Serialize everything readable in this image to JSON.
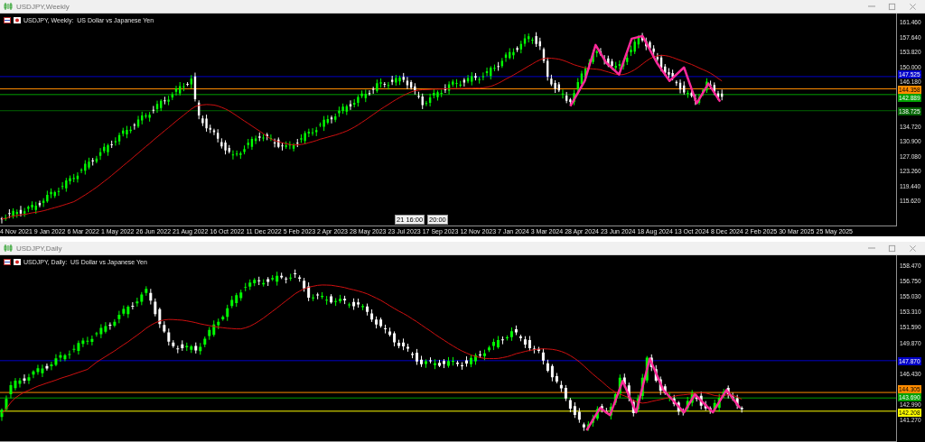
{
  "windows": [
    {
      "title": "USDJPY,Weekly",
      "header": "USDJPY, Weekly:  US Dollar vs Japanese Yen",
      "price_ticks": [
        "161.460",
        "157.640",
        "153.820",
        "150.000",
        "146.180",
        "134.720",
        "130.900",
        "127.080",
        "123.260",
        "119.440",
        "115.620"
      ],
      "levels": [
        {
          "label": "147.525",
          "color": "#0000c8"
        },
        {
          "label": "144.358",
          "color": "#ff8c00"
        },
        {
          "label": "142.889",
          "color": "#00a000"
        },
        {
          "label": "138.725",
          "color": "#006400"
        }
      ],
      "crosshair_labels": [
        "21 16:00",
        "20:00"
      ],
      "time_labels": [
        "4 Nov 2021",
        "9 Jan 2022",
        "6 Mar 2022",
        "1 May 2022",
        "26 Jun 2022",
        "21 Aug 2022",
        "16 Oct 2022",
        "11 Dec 2022",
        "5 Feb 2023",
        "2 Apr 2023",
        "28 May 2023",
        "23 Jul 2023",
        "17 Sep 2023",
        "12 Nov 2023",
        "7 Jan 2024",
        "3 Mar 2024",
        "28 Apr 2024",
        "23 Jun 2024",
        "18 Aug 2024",
        "13 Oct 2024",
        "8 Dec 2024",
        "2 Feb 2025",
        "30 Mar 2025",
        "25 May 2025"
      ]
    },
    {
      "title": "USDJPY,Daily",
      "header": "USDJPY, Daily:  US Dollar vs Japanese Yen",
      "price_ticks": [
        "158.470",
        "156.750",
        "155.030",
        "153.310",
        "151.590",
        "149.870",
        "146.430",
        "142.990",
        "141.270"
      ],
      "levels": [
        {
          "label": "147.870",
          "color": "#0000c8"
        },
        {
          "label": "144.305",
          "color": "#ff8c00"
        },
        {
          "label": "143.690",
          "color": "#00a000"
        },
        {
          "label": "142.208",
          "color": "#ffff00"
        }
      ]
    }
  ]
}
